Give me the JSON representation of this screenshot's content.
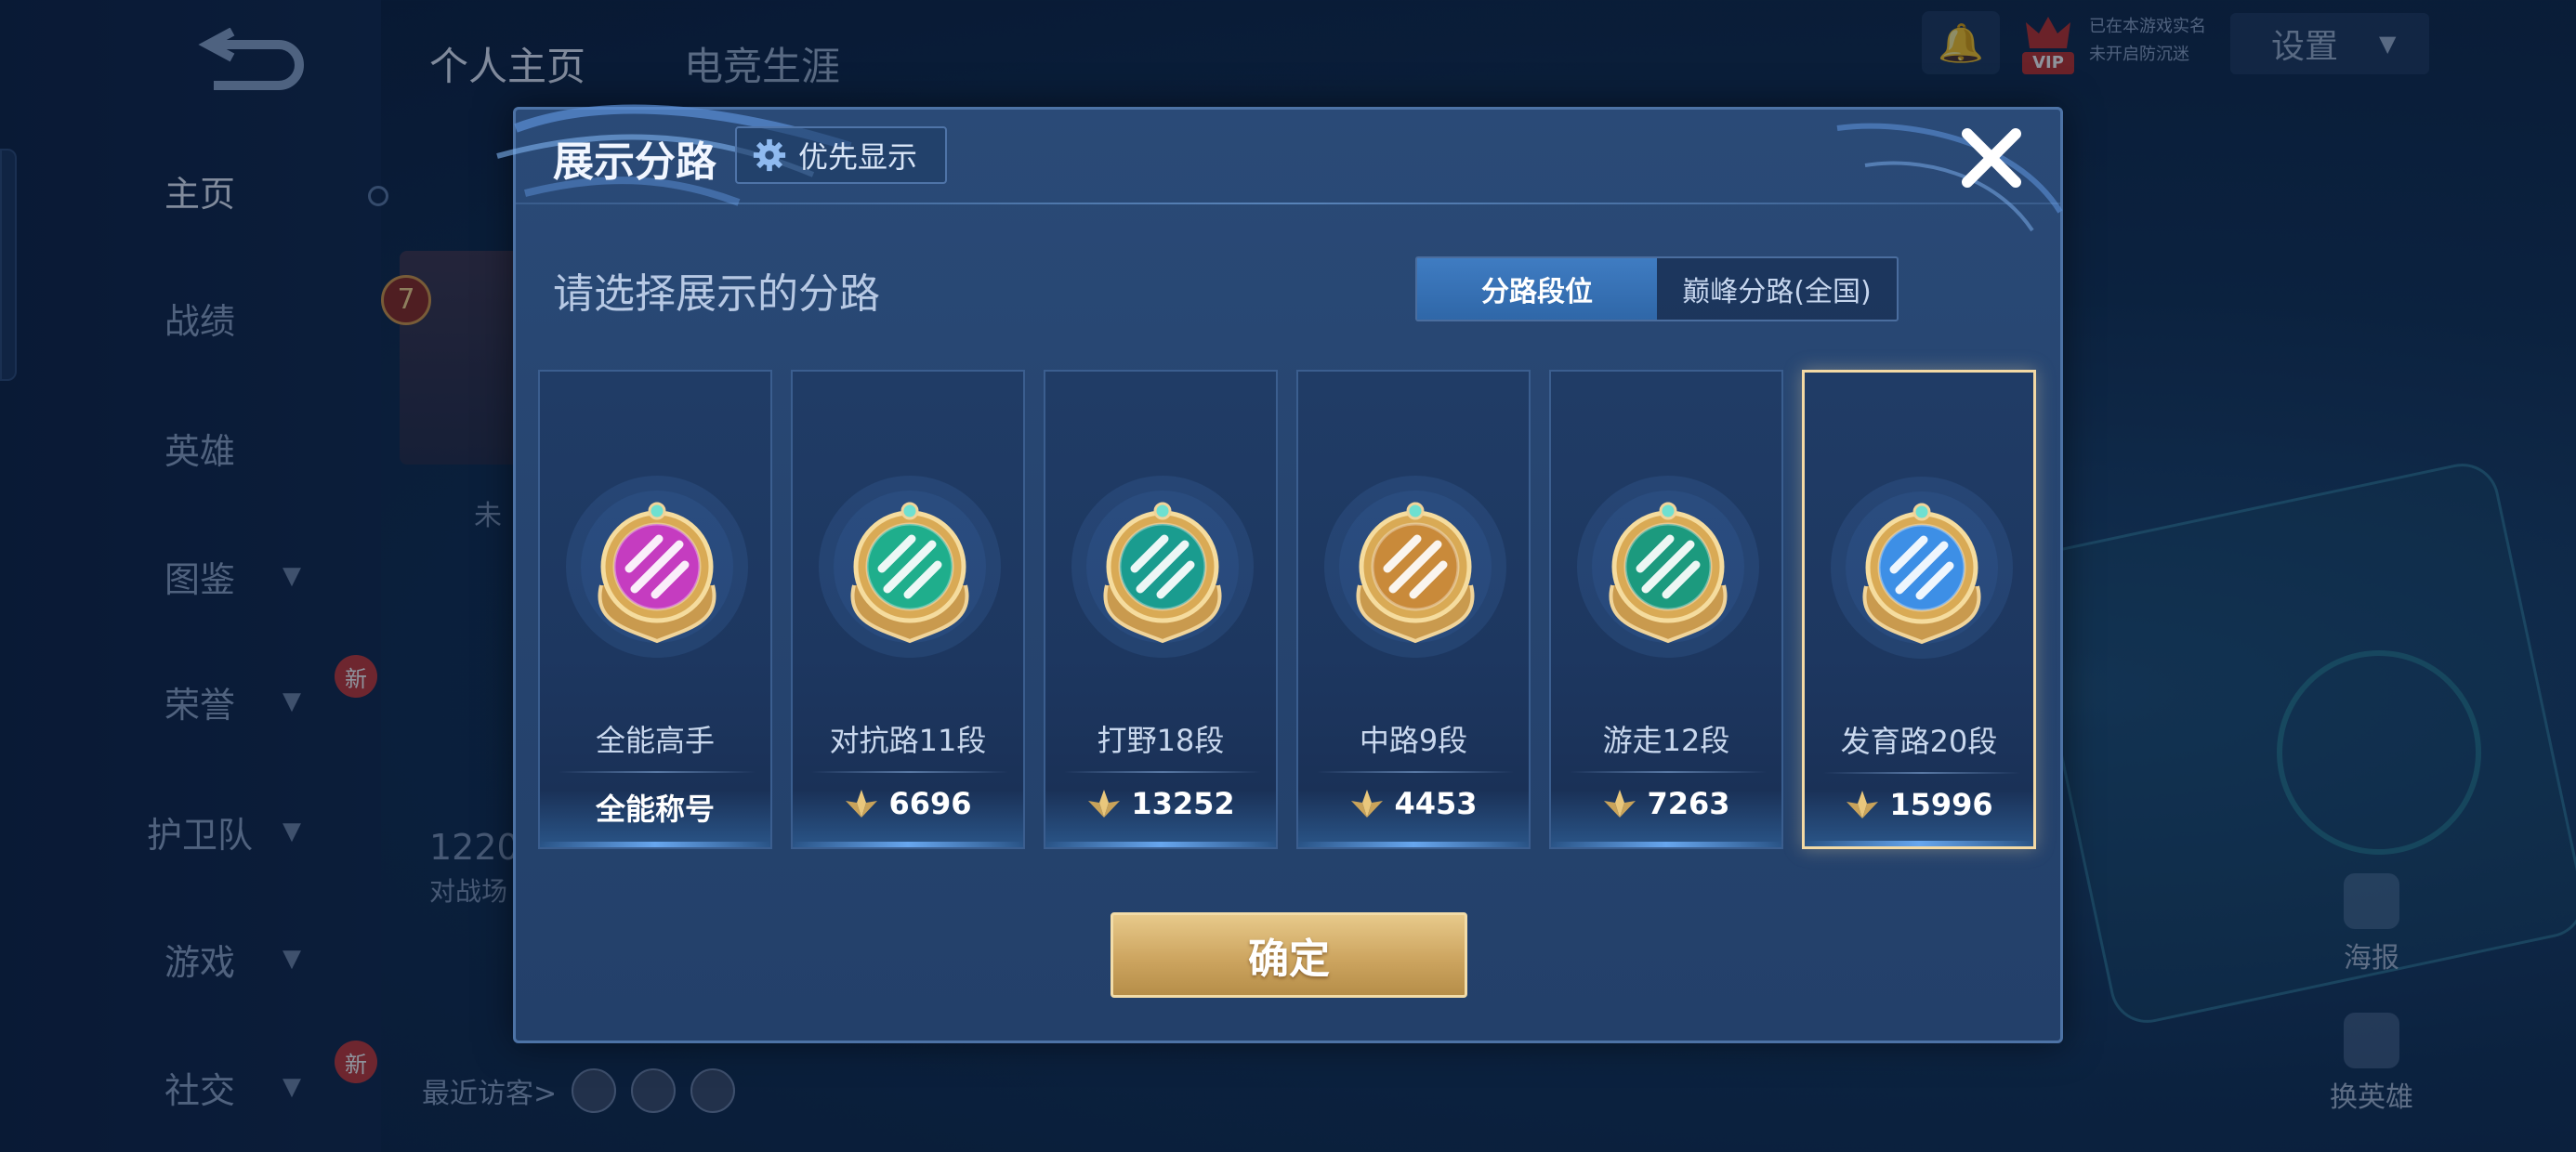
{
  "header": {
    "tabs": [
      "个人主页",
      "电竞生涯"
    ],
    "settings_label": "设置",
    "vip_tag": "VIP",
    "vip_line1": "已在本游戏实名",
    "vip_line2": "未开启防沉迷"
  },
  "sidebar": {
    "items": [
      {
        "label": "主页",
        "chevron": false,
        "badge": ""
      },
      {
        "label": "战绩",
        "chevron": false,
        "badge": ""
      },
      {
        "label": "英雄",
        "chevron": false,
        "badge": ""
      },
      {
        "label": "图鉴",
        "chevron": true,
        "badge": ""
      },
      {
        "label": "荣誉",
        "chevron": true,
        "badge": "新"
      },
      {
        "label": "护卫队",
        "chevron": true,
        "badge": ""
      },
      {
        "label": "游戏",
        "chevron": true,
        "badge": ""
      },
      {
        "label": "社交",
        "chevron": true,
        "badge": "新"
      }
    ]
  },
  "background": {
    "level": "7",
    "partial_text_1": "未",
    "partial_number": "1220",
    "partial_text_2": "对战场",
    "recent_visitors": "最近访客>",
    "poster_label": "海报",
    "change_hero_label": "换英雄"
  },
  "modal": {
    "title": "展示分路",
    "priority_label": "优先显示",
    "subtitle": "请选择展示的分路",
    "segment_tabs": [
      "分路段位",
      "巅峰分路(全国)"
    ],
    "active_segment": 0,
    "confirm_label": "确定",
    "cards": [
      {
        "name": "全能高手",
        "value": "全能称号",
        "has_points_icon": false,
        "emblem": "all-rounder-emblem-icon",
        "color": "#c53cc0",
        "selected": false
      },
      {
        "name": "对抗路11段",
        "value": "6696",
        "has_points_icon": true,
        "emblem": "clash-lane-emblem-icon",
        "color": "#1fae8c",
        "selected": false
      },
      {
        "name": "打野18段",
        "value": "13252",
        "has_points_icon": true,
        "emblem": "jungle-emblem-icon",
        "color": "#1a9c8f",
        "selected": false
      },
      {
        "name": "中路9段",
        "value": "4453",
        "has_points_icon": true,
        "emblem": "mid-lane-emblem-icon",
        "color": "#c98a3a",
        "selected": false
      },
      {
        "name": "游走12段",
        "value": "7263",
        "has_points_icon": true,
        "emblem": "roam-emblem-icon",
        "color": "#1c9a7e",
        "selected": false
      },
      {
        "name": "发育路20段",
        "value": "15996",
        "has_points_icon": true,
        "emblem": "farm-lane-emblem-icon",
        "color": "#3d8fe6",
        "selected": true
      }
    ]
  }
}
